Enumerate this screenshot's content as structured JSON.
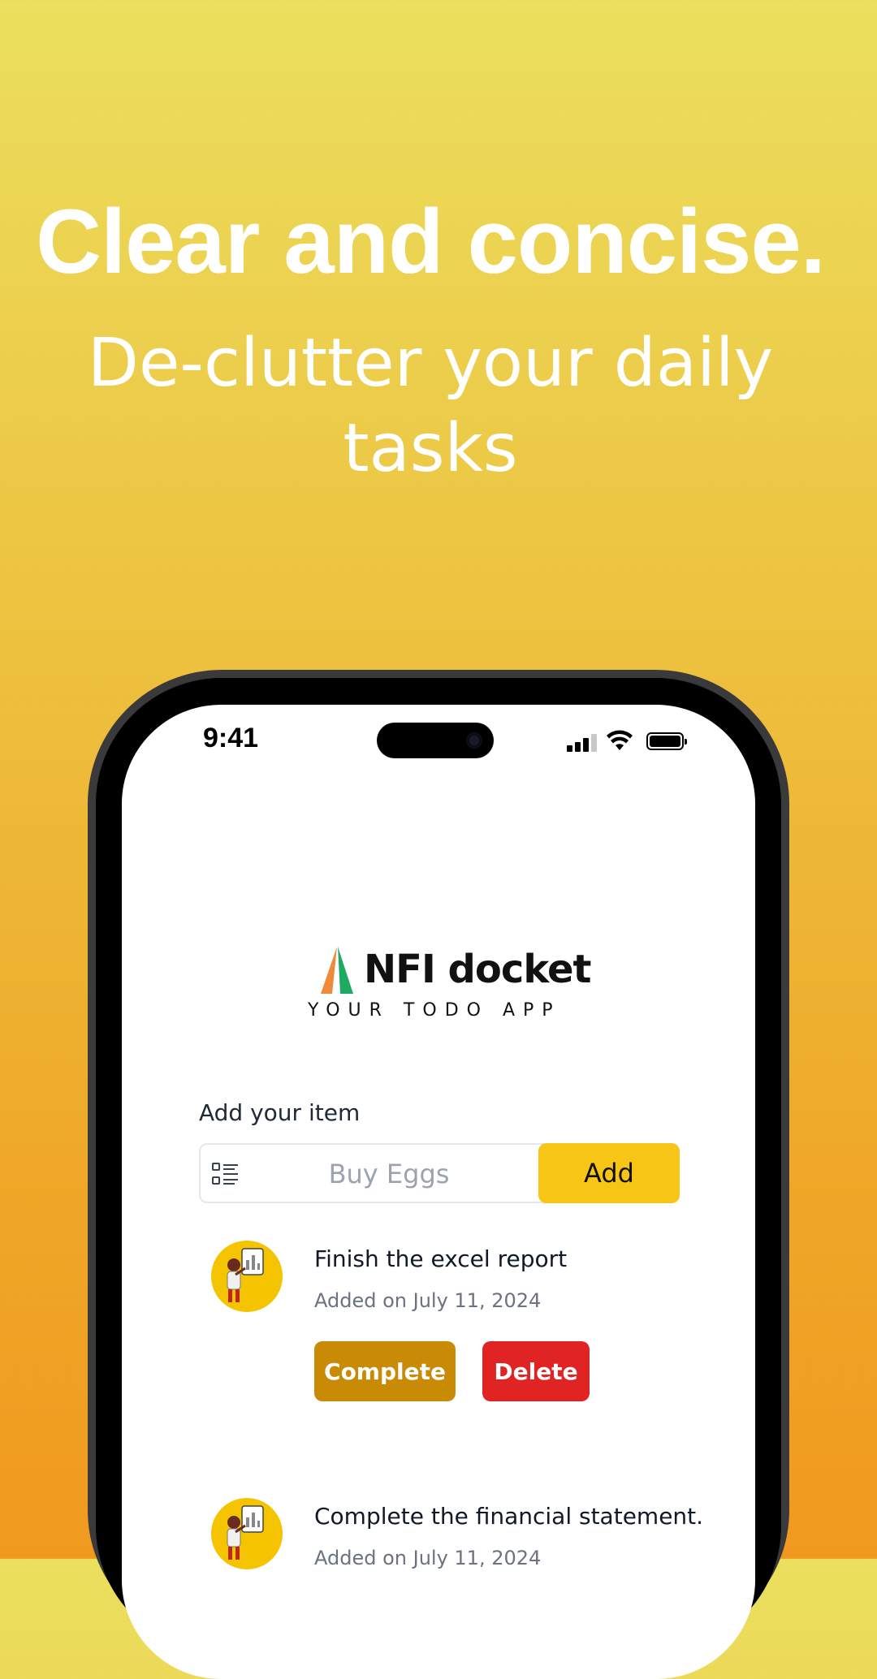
{
  "marketing": {
    "headline": "Clear and concise.",
    "subhead": "De-clutter your daily tasks"
  },
  "status_bar": {
    "time": "9:41"
  },
  "logo": {
    "title": "NFI docket",
    "tagline": "YOUR TODO APP"
  },
  "add_form": {
    "label": "Add your item",
    "placeholder": "Buy Eggs",
    "button_label": "Add"
  },
  "todos": [
    {
      "title": "Finish the excel report",
      "date": "Added on July 11, 2024",
      "complete_label": "Complete",
      "delete_label": "Delete"
    },
    {
      "title": "Complete the financial statement.",
      "date": "Added on July 11, 2024"
    }
  ],
  "colors": {
    "accent": "#f7c515",
    "complete": "#c98a05",
    "delete": "#e02424",
    "avatar_bg": "#f5c400"
  },
  "icons": [
    "signal-icon",
    "wifi-icon",
    "battery-icon",
    "list-icon",
    "logo-mark-icon"
  ]
}
